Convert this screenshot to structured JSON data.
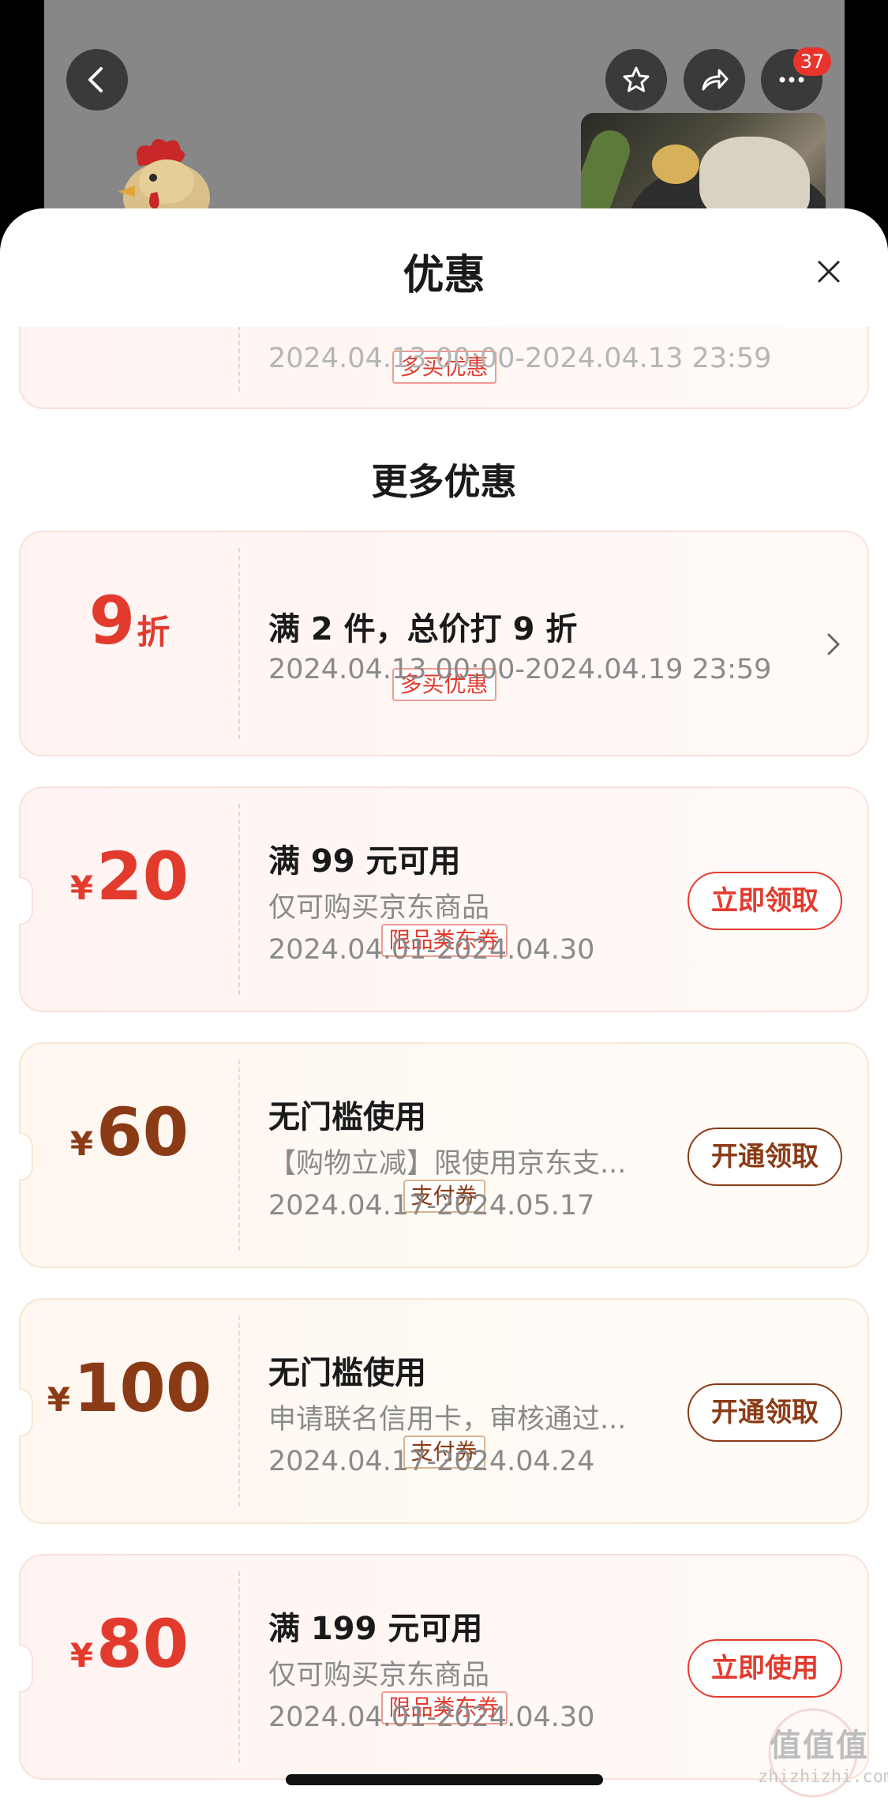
{
  "header": {
    "notification_count": "37"
  },
  "sheet": {
    "title": "优惠",
    "partial_coupon": {
      "tag": "多买优惠",
      "date_partial": "2024.04.13 00:00-2024.04.13 23:59"
    },
    "section_title": "更多优惠",
    "coupons": [
      {
        "style": "red",
        "value": "9",
        "unit": "折",
        "tag": "多买优惠",
        "title": "满 2 件，总价打 9 折",
        "lines": [
          "2024.04.13 00:00-2024.04.19 23:59"
        ],
        "action": ""
      },
      {
        "style": "red",
        "currency": "¥",
        "value": "20",
        "tag": "限品类东券",
        "title": "满 99 元可用",
        "lines": [
          "仅可购买京东商品",
          "2024.04.01-2024.04.30"
        ],
        "action": "立即领取"
      },
      {
        "style": "gold",
        "currency": "¥",
        "value": "60",
        "tag": "支付券",
        "title": "无门槛使用",
        "lines": [
          "【购物立减】限使用京东支...",
          "2024.04.17-2024.05.17"
        ],
        "action": "开通领取"
      },
      {
        "style": "gold",
        "currency": "¥",
        "value": "100",
        "tag": "支付券",
        "title": "无门槛使用",
        "lines": [
          "申请联名信用卡，审核通过...",
          "2024.04.17-2024.04.24"
        ],
        "action": "开通领取"
      },
      {
        "style": "red",
        "currency": "¥",
        "value": "80",
        "tag": "限品类东券",
        "title": "满 199 元可用",
        "lines": [
          "仅可购买京东商品",
          "2024.04.01-2024.04.30"
        ],
        "action": "立即使用"
      }
    ]
  },
  "watermark": {
    "logo": "值值值",
    "site": "zhizhizhi.com"
  },
  "colors": {
    "accent_red": "#e23b2e",
    "accent_brown": "#8a3b16",
    "badge_red": "#e8342b"
  }
}
